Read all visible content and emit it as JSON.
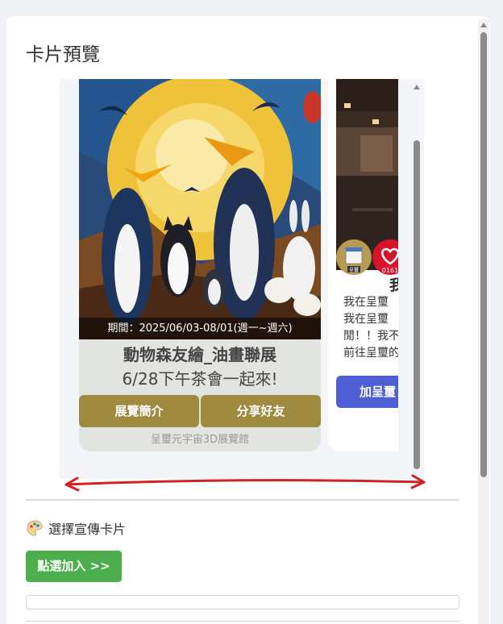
{
  "page": {
    "title": "卡片預覽"
  },
  "card1": {
    "period": "期間：2025/06/03-08/01(週一~週六)",
    "title": "動物森友繪_油畫聯展",
    "subtitle": "6/28下午茶會一起來!",
    "button_left": "展覽簡介",
    "button_right": "分享好友",
    "footer": "呈璽元宇宙3D展覽館"
  },
  "card2": {
    "heading": "我",
    "lines": [
      "我在呈璽",
      "我在呈璽",
      "閒！！我不",
      "前往呈璽的"
    ],
    "button": "加呈璽",
    "badge": "0161",
    "badge_small": "呈璽"
  },
  "select_section": {
    "icon": "palette-icon",
    "label": "選擇宣傳卡片"
  },
  "add_button": {
    "label": "點選加入 >>"
  },
  "colors": {
    "card_button": "#a08a40",
    "card2_button": "#4e5fd6",
    "add_button": "#4cae4c",
    "annotation": "#d42020"
  }
}
